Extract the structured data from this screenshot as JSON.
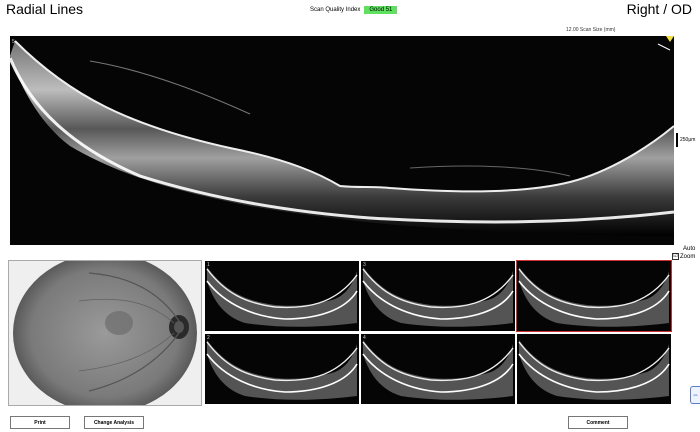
{
  "header": {
    "title": "Radial Lines",
    "eye": "Right / OD",
    "scan_quality_label": "Scan Quality Index",
    "scan_quality_value": "Good  51",
    "scan_size": "12.00 Scan Size (mm)"
  },
  "main_scan": {
    "index": "5",
    "scale_label": "250μm"
  },
  "auto_zoom": {
    "label_line1": "Auto",
    "label_line2": "Zoom",
    "checked": true,
    "check_glyph": "☑"
  },
  "thumbnails": [
    {
      "num": "1"
    },
    {
      "num": "3"
    },
    {
      "num": ""
    },
    {
      "num": "2"
    },
    {
      "num": "4"
    },
    {
      "num": ""
    }
  ],
  "buttons": {
    "print": "Print",
    "change_analysis": "Change Analysis",
    "comment": "Comment"
  },
  "colors": {
    "quality_badge": "#5fe05f",
    "selected_outline": "#d03030"
  },
  "side_tab_icon": "link-icon"
}
